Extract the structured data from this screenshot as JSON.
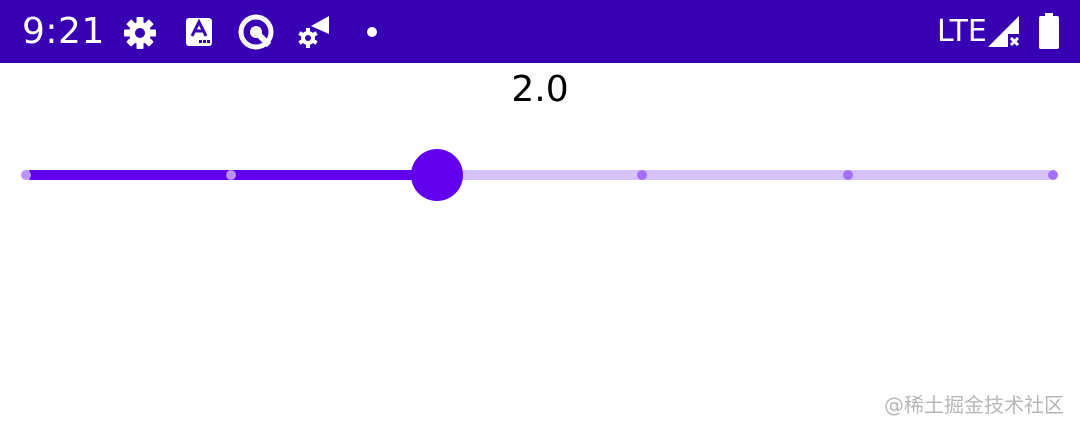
{
  "status_bar": {
    "time": "9:21",
    "network": "LTE",
    "background_color": "#3700b3",
    "icons": [
      "settings-icon",
      "app-notification-icon",
      "sync-icon",
      "wifi-settings-icon",
      "notification-dot-icon",
      "signal-icon",
      "battery-icon"
    ]
  },
  "slider": {
    "value_text": "2.0",
    "min": 0,
    "max": 5,
    "step": 1,
    "value": 2,
    "active_color": "#6200ee",
    "inactive_track_color": "#d5c2fb",
    "inactive_tick_color": "#a370f7",
    "active_tick_color": "#b794f6"
  },
  "watermark": "@稀土掘金技术社区"
}
